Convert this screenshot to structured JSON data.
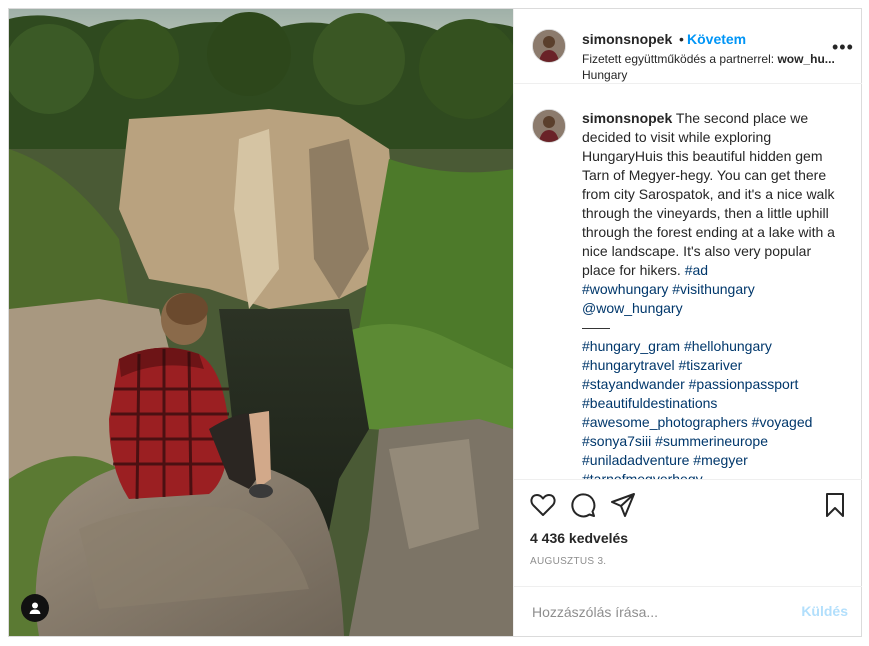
{
  "post": {
    "username": "simonsnopek",
    "dot": "•",
    "follow_label": "Követem",
    "paid_prefix": "Fizetett együttműködés a partnerrel:",
    "paid_partner": "wow_hu...",
    "location": "Hungary",
    "more_label": "•••"
  },
  "caption": {
    "username": "simonsnopek",
    "text": "The second place we decided to visit while exploring HungaryHuis this beautiful hidden gem Tarn of Megyer-hegy. You can get there from city Sarospatok, and it's a nice walk through the vineyards, then a little uphill through the forest ending at a lake with a nice landscape. It's also very popular place for hikers.",
    "tag_ad": "#ad",
    "tag_line1": "#wowhungary #visithungary",
    "mention": "@wow_hungary",
    "separator": "——",
    "hashtag_lines": [
      "#hungary_gram #hellohungary",
      "#hungarytravel #tiszariver",
      "#stayandwander #passionpassport",
      "#beautifuldestinations",
      "#awesome_photographers #voyaged",
      "#sonya7siii #summerineurope",
      "#uniladadventure #megyer",
      "#tarnofmegyerhegy"
    ]
  },
  "engagement": {
    "likes": "4 436 kedvelés",
    "date": "AUGUSZTUS 3."
  },
  "comment_box": {
    "placeholder": "Hozzászólás írása...",
    "post_label": "Küldés"
  },
  "icons": {
    "like": "heart-icon",
    "comment": "comment-icon",
    "share": "send-icon",
    "save": "bookmark-icon",
    "user_tag": "user-tag-icon",
    "more": "more-options-icon"
  },
  "colors": {
    "link": "#0095f6",
    "hashtag": "#00376b",
    "text": "#262626",
    "muted": "#8e8e8e",
    "post_disabled": "#b2dffc"
  }
}
